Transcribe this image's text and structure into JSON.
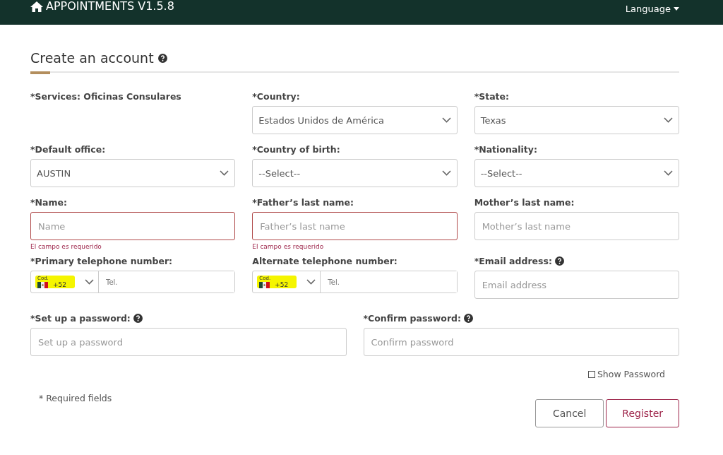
{
  "navbar": {
    "brand": "APPOINTMENTS V1.5.8",
    "language": "Language"
  },
  "title": "Create an account",
  "rows": [
    {
      "fields": [
        {
          "kind": "text",
          "label": "*Services: Oficinas Consulares"
        },
        {
          "kind": "select",
          "label": "*Country:",
          "value": "Estados Unidos de América"
        },
        {
          "kind": "select",
          "label": "*State:",
          "value": "Texas"
        }
      ]
    },
    {
      "fields": [
        {
          "kind": "select",
          "label": "*Default office:",
          "value": "AUSTIN"
        },
        {
          "kind": "select",
          "label": "*Country of birth:",
          "value": "--Select--"
        },
        {
          "kind": "select",
          "label": "*Nationality:",
          "value": "--Select--"
        }
      ]
    },
    {
      "fields": [
        {
          "kind": "input",
          "label": "*Name:",
          "placeholder": "Name",
          "invalid": true,
          "error": "El campo es requerido"
        },
        {
          "kind": "input",
          "label": "*Father’s last name:",
          "placeholder": "Father’s last name",
          "invalid": true,
          "error": "El campo es requerido"
        },
        {
          "kind": "input",
          "label": "Mother’s last name:",
          "placeholder": "Mother’s last name",
          "invalid": false
        }
      ]
    },
    {
      "fields": [
        {
          "kind": "phone",
          "label": "*Primary telephone number:",
          "code_label": "Cod.",
          "code": "+52",
          "placeholder": "Tel.",
          "highlighted": true
        },
        {
          "kind": "phone",
          "label": "Alternate telephone number:",
          "code_label": "Cod.",
          "code": "+52",
          "placeholder": "Tel.",
          "highlighted": true
        },
        {
          "kind": "input",
          "label": "*Email address:",
          "help": true,
          "placeholder": "Email address",
          "invalid": false
        }
      ]
    },
    {
      "fields": [
        {
          "kind": "input",
          "label": "*Set up a password:",
          "help": true,
          "placeholder": "Set up a password",
          "invalid": false
        },
        {
          "kind": "input",
          "label": "*Confirm password:",
          "help": true,
          "placeholder": "Confirm password",
          "invalid": false
        }
      ]
    }
  ],
  "show_password": {
    "label": "Show Password",
    "checked": false
  },
  "required_note": "* Required fields",
  "buttons": [
    {
      "kind": "cancel",
      "label": "Cancel"
    },
    {
      "kind": "register",
      "label": "Register"
    }
  ]
}
